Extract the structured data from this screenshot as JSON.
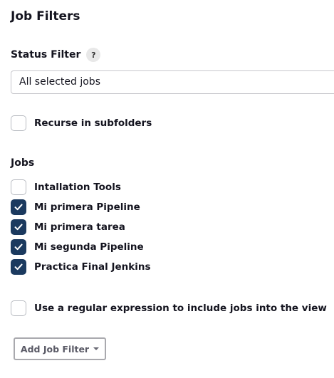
{
  "section": {
    "title": "Job Filters"
  },
  "status_filter": {
    "label": "Status Filter",
    "help": "?",
    "selected": "All selected jobs"
  },
  "recurse": {
    "label": "Recurse in subfolders",
    "checked": false
  },
  "jobs": {
    "label": "Jobs",
    "items": [
      {
        "label": "Intallation Tools",
        "checked": false
      },
      {
        "label": "Mi primera Pipeline",
        "checked": true
      },
      {
        "label": "Mi primera tarea",
        "checked": true
      },
      {
        "label": "Mi segunda Pipeline",
        "checked": true
      },
      {
        "label": "Practica Final Jenkins",
        "checked": true
      }
    ]
  },
  "regex": {
    "label": "Use a regular expression to include jobs into the view",
    "checked": false,
    "help": "?"
  },
  "add_filter": {
    "label": "Add Job Filter"
  },
  "colors": {
    "checkbox_checked": "#1b3a5f",
    "checkbox_border": "#b9bcc2",
    "text": "#14141f"
  }
}
